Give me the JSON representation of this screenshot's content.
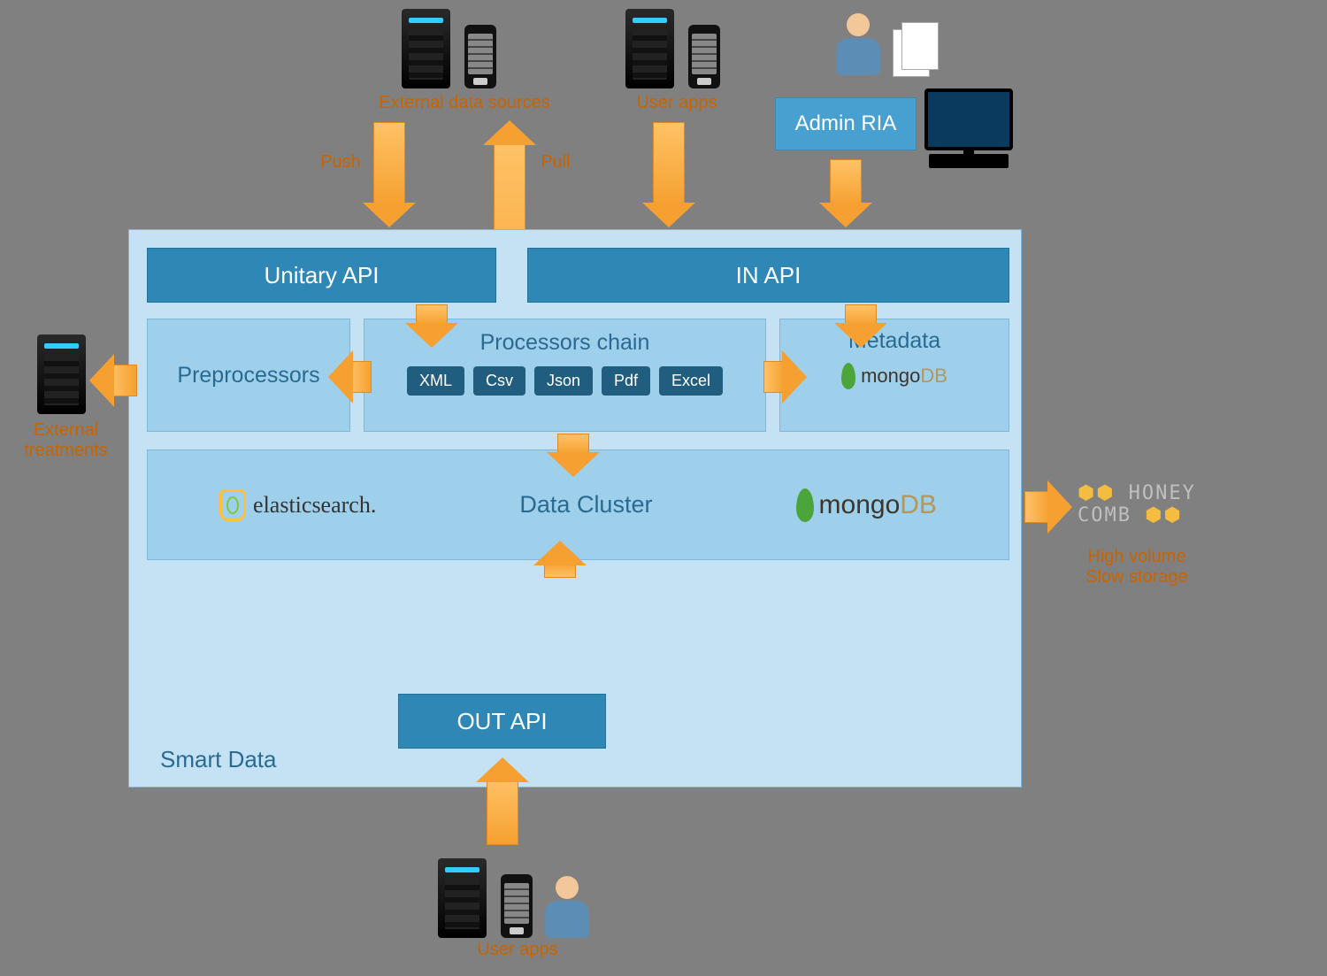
{
  "external_data_sources_label": "External data sources",
  "user_apps_top_label": "User apps",
  "admin_ria_label": "Admin RIA",
  "push_label": "Push",
  "pull_label": "Pull",
  "smart_data_title": "Smart Data",
  "unitary_api_label": "Unitary API",
  "in_api_label": "IN API",
  "preprocessors_label": "Preprocessors",
  "processors_chain_label": "Processors chain",
  "metadata_label": "Metadata",
  "data_cluster_label": "Data Cluster",
  "out_api_label": "OUT API",
  "external_treatments_label": "External\ntreatments",
  "high_volume_label": "High volume\nSlow storage",
  "user_apps_bottom_label": "User apps",
  "processors": {
    "xml": "XML",
    "csv": "Csv",
    "json": "Json",
    "pdf": "Pdf",
    "excel": "Excel"
  },
  "brands": {
    "elasticsearch": "elasticsearch.",
    "mongo_prefix": "mongo",
    "mongo_suffix": "DB",
    "honeycomb_line1": "HONEY",
    "honeycomb_line2": "COMB"
  }
}
